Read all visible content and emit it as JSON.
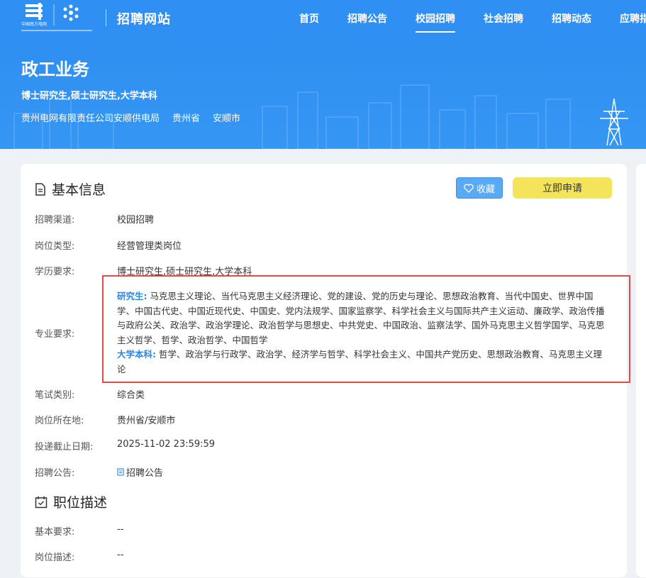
{
  "header": {
    "logo_text": "中国南方电网",
    "site_title": "招聘网站",
    "nav": [
      "首页",
      "招聘公告",
      "校园招聘",
      "社会招聘",
      "招聘动态",
      "应聘指南"
    ],
    "active_nav": "校园招聘"
  },
  "banner": {
    "title": "政工业务",
    "degree": "博士研究生,硕士研究生,大学本科",
    "company": "贵州电网有限责任公司安顺供电局",
    "province": "贵州省",
    "city": "安顺市"
  },
  "basic_info": {
    "heading": "基本信息",
    "fav_label": "收藏",
    "apply_label": "立即申请",
    "channel_key": "招聘渠道:",
    "channel_val": "校园招聘",
    "type_key": "岗位类型:",
    "type_val": "经营管理类岗位",
    "edu_key": "学历要求:",
    "edu_val": "博士研究生,硕士研究生,大学本科",
    "major_key": "专业要求:",
    "major_grad_label": "研究生:",
    "major_grad_text": " 马克思主义理论、当代马克思主义经济理论、党的建设、党的历史与理论、思想政治教育、当代中国史、世界中国学、中国古代史、中国近现代史、中国史、党内法规学、国家监察学、科学社会主义与国际共产主义运动、廉政学、政治传播与政府公关、政治学、政治学理论、政治哲学与思想史、中共党史、中国政治、监察法学、国外马克思主义哲学国学、马克思主义哲学、哲学、政治哲学、中国哲学",
    "major_ug_label": "大学本科:",
    "major_ug_text": " 哲学、政治学与行政学、政治学、经济学与哲学、科学社会主义、中国共产党历史、思想政治教育、马克思主义理论",
    "exam_key": "笔试类别:",
    "exam_val": "综合类",
    "loc_key": "岗位所在地:",
    "loc_val": "贵州省/安顺市",
    "deadline_key": "投递截止日期:",
    "deadline_val": "2025-11-02 23:59:59",
    "notice_key": "招聘公告:",
    "notice_val": "招聘公告"
  },
  "description": {
    "heading": "职位描述",
    "req_key": "基本要求:",
    "req_val": "--",
    "desc_key": "岗位描述:",
    "desc_val": "--"
  }
}
